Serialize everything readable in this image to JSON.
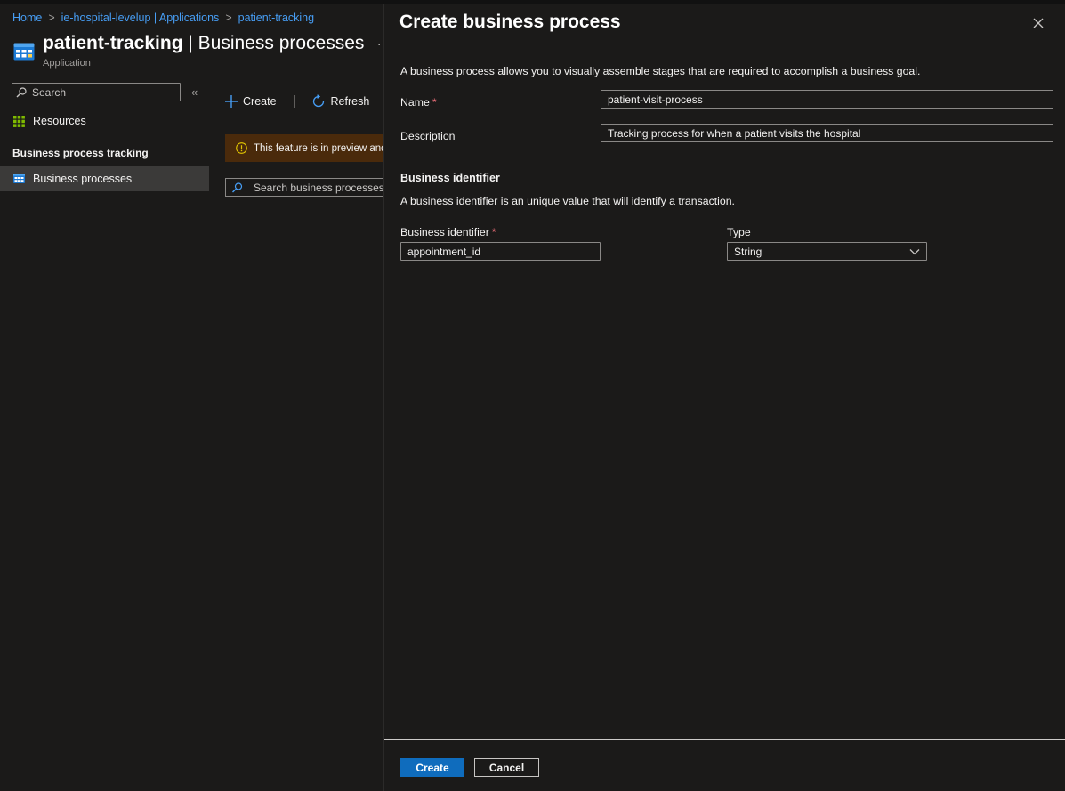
{
  "breadcrumb": {
    "items": [
      "Home",
      "ie-hospital-levelup | Applications",
      "patient-tracking"
    ],
    "separator": ">"
  },
  "page": {
    "title_bold": "patient-tracking",
    "title_rest": " | Business processes",
    "subtitle": "Application",
    "more": "···"
  },
  "sidebar": {
    "search_placeholder": "Search",
    "collapse": "«",
    "items": [
      {
        "label": "Resources",
        "icon": "grid-icon"
      },
      {
        "label": "Business processes",
        "icon": "table-icon",
        "selected": true
      }
    ],
    "section_heading": "Business process tracking"
  },
  "commandbar": {
    "create_label": "Create",
    "refresh_label": "Refresh"
  },
  "banner": {
    "text": "This feature is in preview and may change."
  },
  "list": {
    "search_placeholder": "Search business processes..."
  },
  "panel": {
    "title": "Create business process",
    "intro": "A business process allows you to visually assemble stages that are required to accomplish a business goal.",
    "name_label": "Name",
    "name_value": "patient-visit-process",
    "description_label": "Description",
    "description_value": "Tracking process for when a patient visits the hospital",
    "identifier_section_title": "Business identifier",
    "identifier_section_desc": "A business identifier is an unique value that will identify a transaction.",
    "identifier_label": "Business identifier",
    "identifier_value": "appointment_id",
    "type_label": "Type",
    "type_value": "String",
    "required_mark": "*",
    "create_button": "Create",
    "cancel_button": "Cancel"
  },
  "colors": {
    "accent": "#0f6cbd",
    "link": "#479ef5",
    "required": "#f1707b",
    "warning_bg": "#4a2a0b",
    "background": "#1b1a19"
  }
}
